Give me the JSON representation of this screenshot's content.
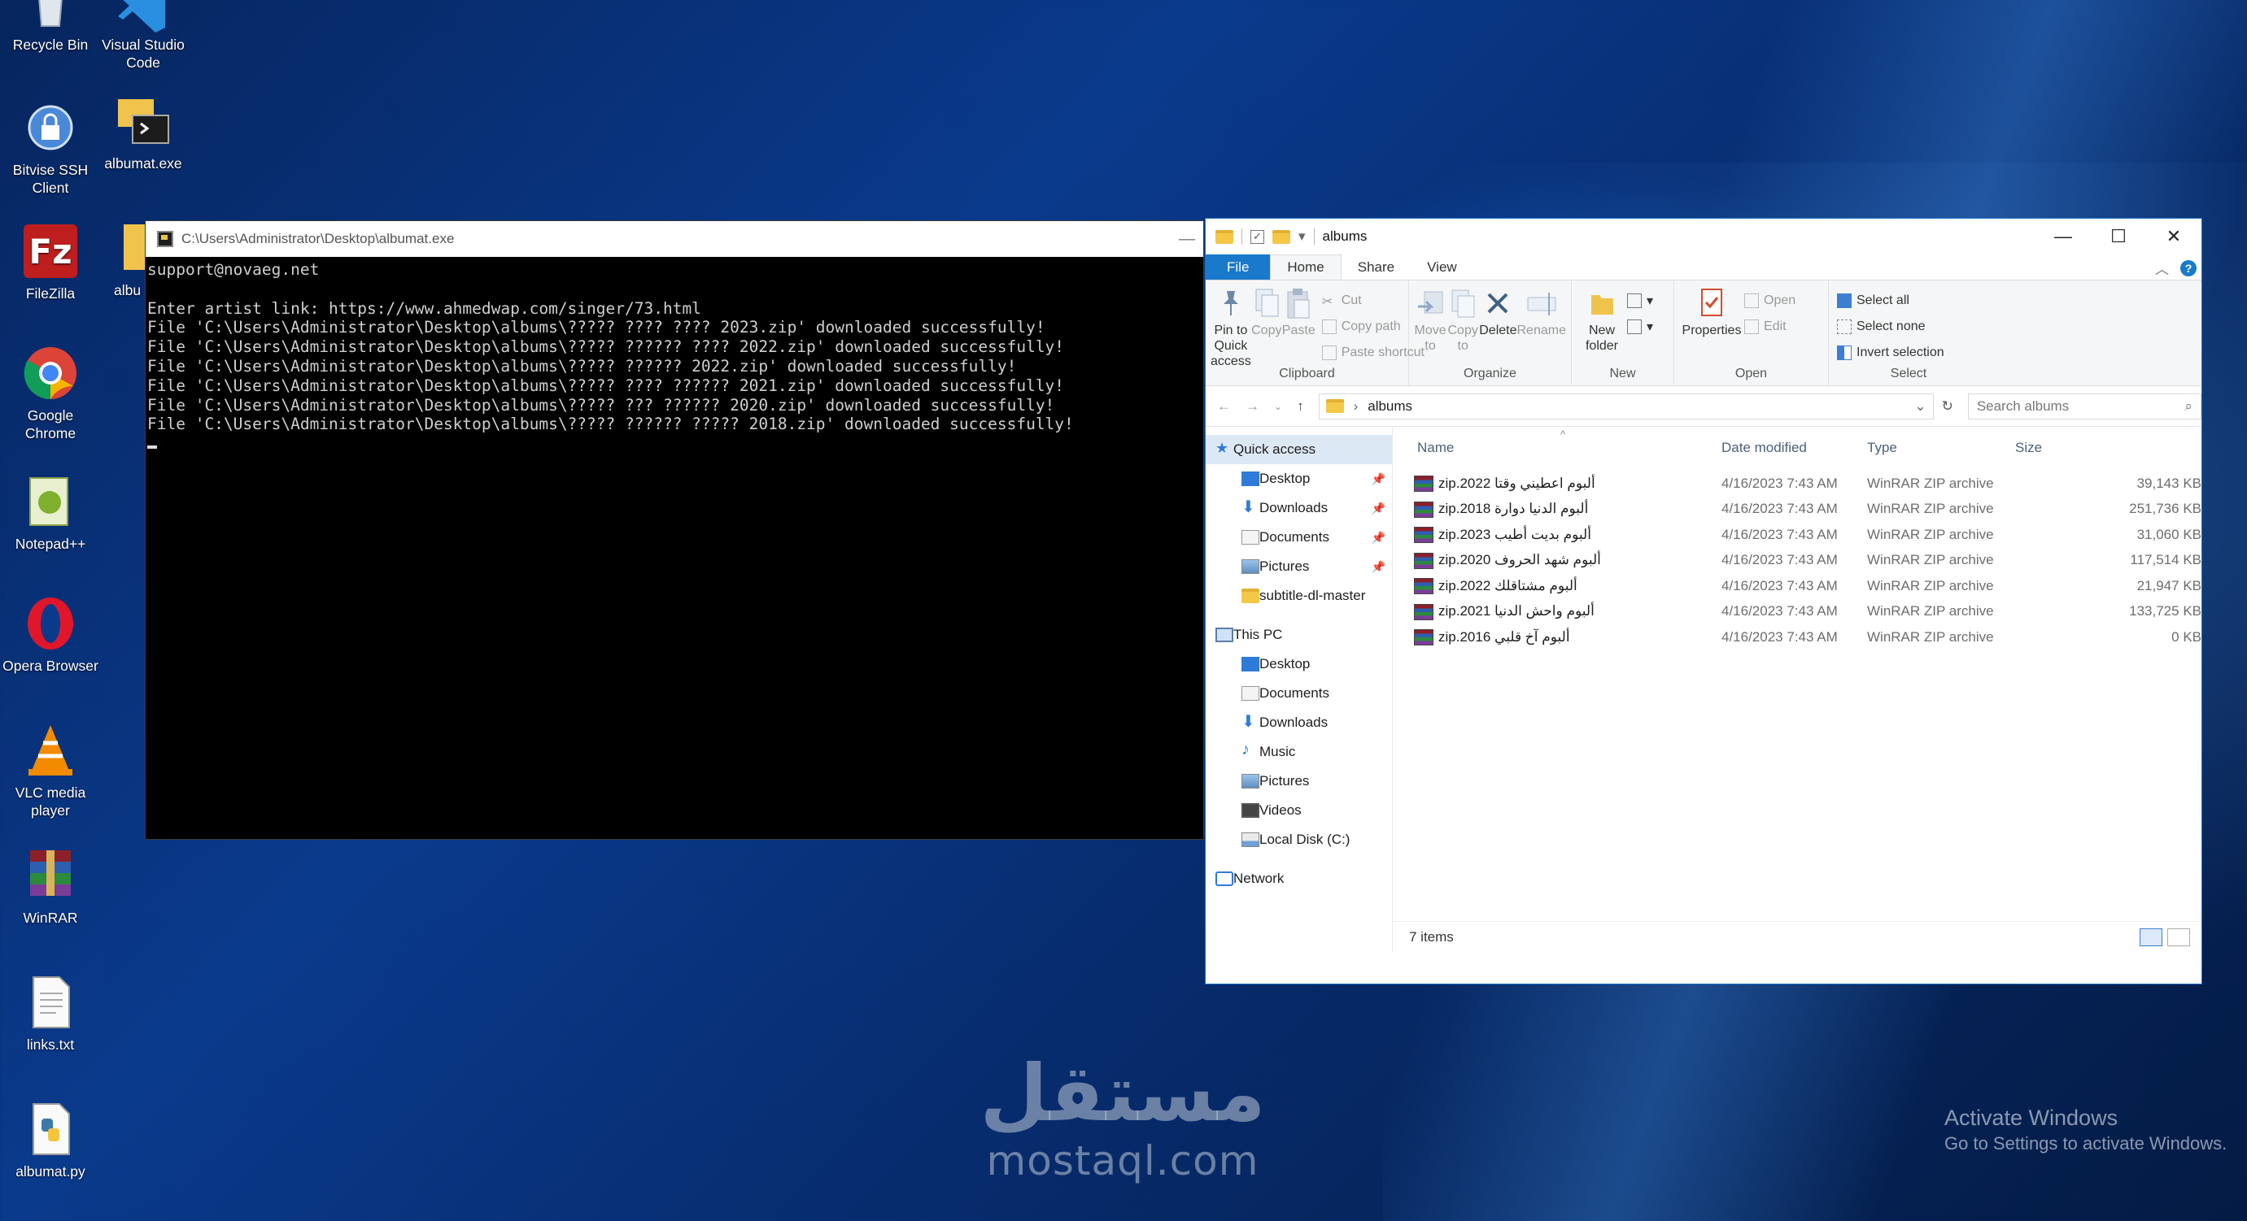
{
  "desktop": {
    "icons": [
      {
        "label": "Recycle Bin",
        "icon": "recycle-bin-icon"
      },
      {
        "label": "Visual Studio Code",
        "icon": "vscode-icon"
      },
      {
        "label": "Bitvise SSH Client",
        "icon": "bitvise-icon"
      },
      {
        "label": "albumat.exe",
        "icon": "albumat-exe-icon"
      },
      {
        "label": "FileZilla",
        "icon": "filezilla-icon"
      },
      {
        "label": "albu",
        "icon": "folder-icon"
      },
      {
        "label": "Google Chrome",
        "icon": "chrome-icon"
      },
      {
        "label": "Notepad++",
        "icon": "notepadpp-icon"
      },
      {
        "label": "Opera Browser",
        "icon": "opera-icon"
      },
      {
        "label": "VLC media player",
        "icon": "vlc-icon"
      },
      {
        "label": "WinRAR",
        "icon": "winrar-icon"
      },
      {
        "label": "links.txt",
        "icon": "text-file-icon"
      },
      {
        "label": "albumat.py",
        "icon": "python-file-icon"
      }
    ]
  },
  "console": {
    "title": "C:\\Users\\Administrator\\Desktop\\albumat.exe",
    "minimize": "—",
    "lines": [
      "support@novaeg.net",
      "",
      "Enter artist link: https://www.ahmedwap.com/singer/73.html",
      "File 'C:\\Users\\Administrator\\Desktop\\albums\\????? ???? ???? 2023.zip' downloaded successfully!",
      "File 'C:\\Users\\Administrator\\Desktop\\albums\\????? ?????? ???? 2022.zip' downloaded successfully!",
      "File 'C:\\Users\\Administrator\\Desktop\\albums\\????? ?????? 2022.zip' downloaded successfully!",
      "File 'C:\\Users\\Administrator\\Desktop\\albums\\????? ???? ?????? 2021.zip' downloaded successfully!",
      "File 'C:\\Users\\Administrator\\Desktop\\albums\\????? ??? ?????? 2020.zip' downloaded successfully!",
      "File 'C:\\Users\\Administrator\\Desktop\\albums\\????? ?????? ????? 2018.zip' downloaded successfully!"
    ]
  },
  "explorer": {
    "title": "albums",
    "controls": {
      "minimize": "—",
      "maximize": "☐",
      "close": "✕"
    },
    "tabs": {
      "file": "File",
      "home": "Home",
      "share": "Share",
      "view": "View"
    },
    "ribbon": {
      "clipboard": {
        "label": "Clipboard",
        "pin": "Pin to Quick access",
        "copy": "Copy",
        "paste": "Paste",
        "cut": "Cut",
        "copy_path": "Copy path",
        "paste_shortcut": "Paste shortcut"
      },
      "organize": {
        "label": "Organize",
        "move_to": "Move to",
        "copy_to": "Copy to",
        "delete": "Delete",
        "rename": "Rename"
      },
      "new": {
        "label": "New",
        "new_folder": "New folder"
      },
      "open": {
        "label": "Open",
        "properties": "Properties",
        "open": "Open",
        "edit": "Edit"
      },
      "select": {
        "label": "Select",
        "select_all": "Select all",
        "select_none": "Select none",
        "invert": "Invert selection"
      }
    },
    "address": {
      "path": "albums",
      "search_placeholder": "Search albums"
    },
    "nav": {
      "quick_access": "Quick access",
      "quick_items": [
        "Desktop",
        "Downloads",
        "Documents",
        "Pictures",
        "subtitle-dl-master"
      ],
      "this_pc": "This PC",
      "pc_items": [
        "Desktop",
        "Documents",
        "Downloads",
        "Music",
        "Pictures",
        "Videos",
        "Local Disk (C:)"
      ],
      "network": "Network"
    },
    "columns": {
      "name": "Name",
      "date": "Date modified",
      "type": "Type",
      "size": "Size"
    },
    "files": [
      {
        "name": "ألبوم اعطيني وقتا 2022.zip",
        "date": "4/16/2023 7:43 AM",
        "type": "WinRAR ZIP archive",
        "size": "39,143 KB"
      },
      {
        "name": "ألبوم الدنيا دوارة 2018.zip",
        "date": "4/16/2023 7:43 AM",
        "type": "WinRAR ZIP archive",
        "size": "251,736 KB"
      },
      {
        "name": "ألبوم بديت أطيب 2023.zip",
        "date": "4/16/2023 7:43 AM",
        "type": "WinRAR ZIP archive",
        "size": "31,060 KB"
      },
      {
        "name": "ألبوم شهد الحروف 2020.zip",
        "date": "4/16/2023 7:43 AM",
        "type": "WinRAR ZIP archive",
        "size": "117,514 KB"
      },
      {
        "name": "ألبوم مشتاقلك 2022.zip",
        "date": "4/16/2023 7:43 AM",
        "type": "WinRAR ZIP archive",
        "size": "21,947 KB"
      },
      {
        "name": "ألبوم واحش الدنيا 2021.zip",
        "date": "4/16/2023 7:43 AM",
        "type": "WinRAR ZIP archive",
        "size": "133,725 KB"
      },
      {
        "name": "ألبوم آخ قلبي 2016.zip",
        "date": "4/16/2023 7:43 AM",
        "type": "WinRAR ZIP archive",
        "size": "0 KB"
      }
    ],
    "status": "7 items"
  },
  "watermark": {
    "arabic": "مستقل",
    "latin": "mostaql.com"
  },
  "activation": {
    "line1": "Activate Windows",
    "line2": "Go to Settings to activate Windows."
  }
}
